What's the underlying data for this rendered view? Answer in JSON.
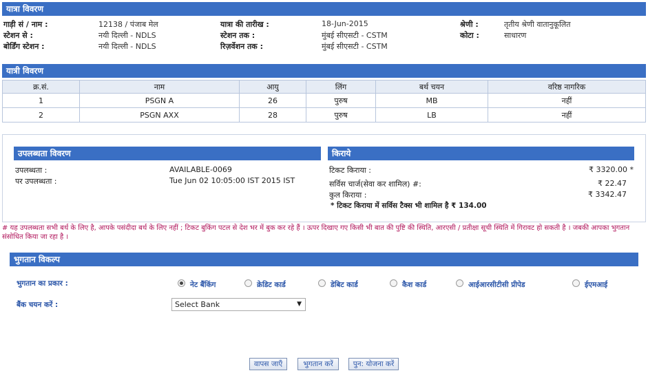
{
  "journey": {
    "title": "यात्रा विवरण",
    "train_label": "गाड़ी सं / नाम :",
    "train_value": "12138 / पंजाब मेल",
    "date_label": "यात्रा की तारीख :",
    "date_value": "18-Jun-2015",
    "class_label": "श्रेणी :",
    "class_value": "तृतीय श्रेणी वातानुकूलित",
    "from_label": "स्टेशन से :",
    "from_value": "नयी दिल्ली - NDLS",
    "to_label": "स्टेशन तक :",
    "to_value": "मुंबई सीएसटी - CSTM",
    "quota_label": "कोटा :",
    "quota_value": "साधारण",
    "boarding_label": "बोर्डिंग स्टेशन :",
    "boarding_value": "नयी दिल्ली - NDLS",
    "reservation_label": "रिज़र्वेशन तक :",
    "reservation_value": "मुंबई सीएसटी - CSTM"
  },
  "passengers": {
    "title": "यात्री विवरण",
    "headers": [
      "क्र.सं.",
      "नाम",
      "आयु",
      "लिंग",
      "बर्थ चयन",
      "वरिष्ठ नागरिक"
    ],
    "rows": [
      [
        "1",
        "PSGN A",
        "26",
        "पुरुष",
        "MB",
        "नहीं"
      ],
      [
        "2",
        "PSGN AXX",
        "28",
        "पुरुष",
        "LB",
        "नहीं"
      ]
    ]
  },
  "availability": {
    "title": "उपलब्धता विवरण",
    "avail_label": "उपलब्धता :",
    "avail_value": "AVAILABLE-0069",
    "asof_label": "पर उपलब्धता :",
    "asof_value": "Tue Jun 02 10:05:00 IST 2015 IST"
  },
  "fare": {
    "title": "किराये",
    "ticket_label": "टिकट किराया :",
    "ticket_value": "₹ 3320.00 *",
    "service_label": "सर्विस चार्ज(सेवा कर शामिल) #:",
    "service_value": "₹ 22.47",
    "total_label": "कुल किराया :",
    "total_value": "₹ 3342.47",
    "tax_note": "* टिकट किराया में सर्विस टैक्स भी शामिल है ₹ 134.00"
  },
  "note": "# यह उपलब्धता सभी बर्थ के लिए है, आपके पसंदीदा बर्थ के लिए नहीं ; टिकट बुकिंग पटल से देश भर में बुक कर रहे हैं । ऊपर दिखाए गए किसी भी बात की पुष्टि की स्थिति, आरएसी / प्रतीक्षा सूची स्थिति में गिरावट हो सकती है । जबकी आपका भुगतान संसोधित किया जा रहा है ।",
  "payment": {
    "title": "भुगतान विकल्प",
    "type_label": "भुगतान का प्रकार :",
    "options": [
      "नेट बैंकिंग",
      "क्रेडिट कार्ड",
      "डेबिट कार्ड",
      "कैश कार्ड",
      "आईआरसीटीसी प्रीपेड",
      "ईएमआई"
    ],
    "selected": "नेट बैंकिंग",
    "bank_label": "बैंक चयन करें :",
    "bank_select": "Select Bank"
  },
  "buttons": {
    "back": "वापस जाएँ",
    "pay": "भुगतान करें",
    "replan": "पुन: योजना करें"
  },
  "colors": {
    "header_bar": "#3a6fc4",
    "note_text": "#b1175c",
    "link_text": "#2a55a8"
  }
}
